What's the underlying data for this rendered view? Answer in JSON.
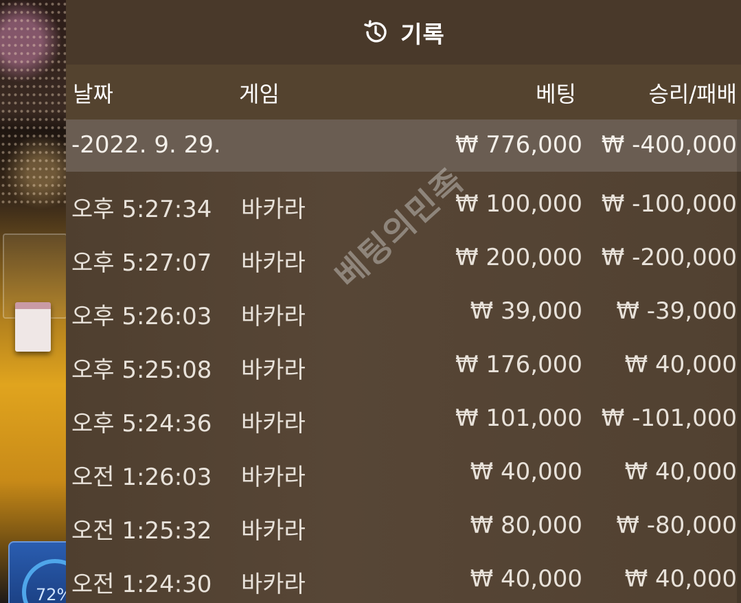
{
  "header": {
    "title": "기록",
    "icon": "history-icon"
  },
  "columns": {
    "date": "날짜",
    "game": "게임",
    "bet": "베팅",
    "result": "승리/패배"
  },
  "summary": {
    "date": "-2022. 9. 29.",
    "bet": "₩ 776,000",
    "result": "₩ -400,000"
  },
  "rows": [
    {
      "time": "오후 5:27:34",
      "game": "바카라",
      "bet": "₩ 100,000",
      "result": "₩ -100,000"
    },
    {
      "time": "오후 5:27:07",
      "game": "바카라",
      "bet": "₩ 200,000",
      "result": "₩ -200,000"
    },
    {
      "time": "오후 5:26:03",
      "game": "바카라",
      "bet": "₩ 39,000",
      "result": "₩ -39,000"
    },
    {
      "time": "오후 5:25:08",
      "game": "바카라",
      "bet": "₩ 176,000",
      "result": "₩ 40,000"
    },
    {
      "time": "오후 5:24:36",
      "game": "바카라",
      "bet": "₩ 101,000",
      "result": "₩ -101,000"
    },
    {
      "time": "오전 1:26:03",
      "game": "바카라",
      "bet": "₩ 40,000",
      "result": "₩ 40,000"
    },
    {
      "time": "오전 1:25:32",
      "game": "바카라",
      "bet": "₩ 80,000",
      "result": "₩ -80,000"
    },
    {
      "time": "오전 1:24:30",
      "game": "바카라",
      "bet": "₩ 40,000",
      "result": "₩ 40,000"
    }
  ],
  "badge": {
    "percent": "72%"
  },
  "watermark": "베팅의민족",
  "colors": {
    "panel_bg": "#564535",
    "header_bg": "#49392a",
    "summary_bg": "#6a5d52",
    "text": "#ffffff"
  }
}
